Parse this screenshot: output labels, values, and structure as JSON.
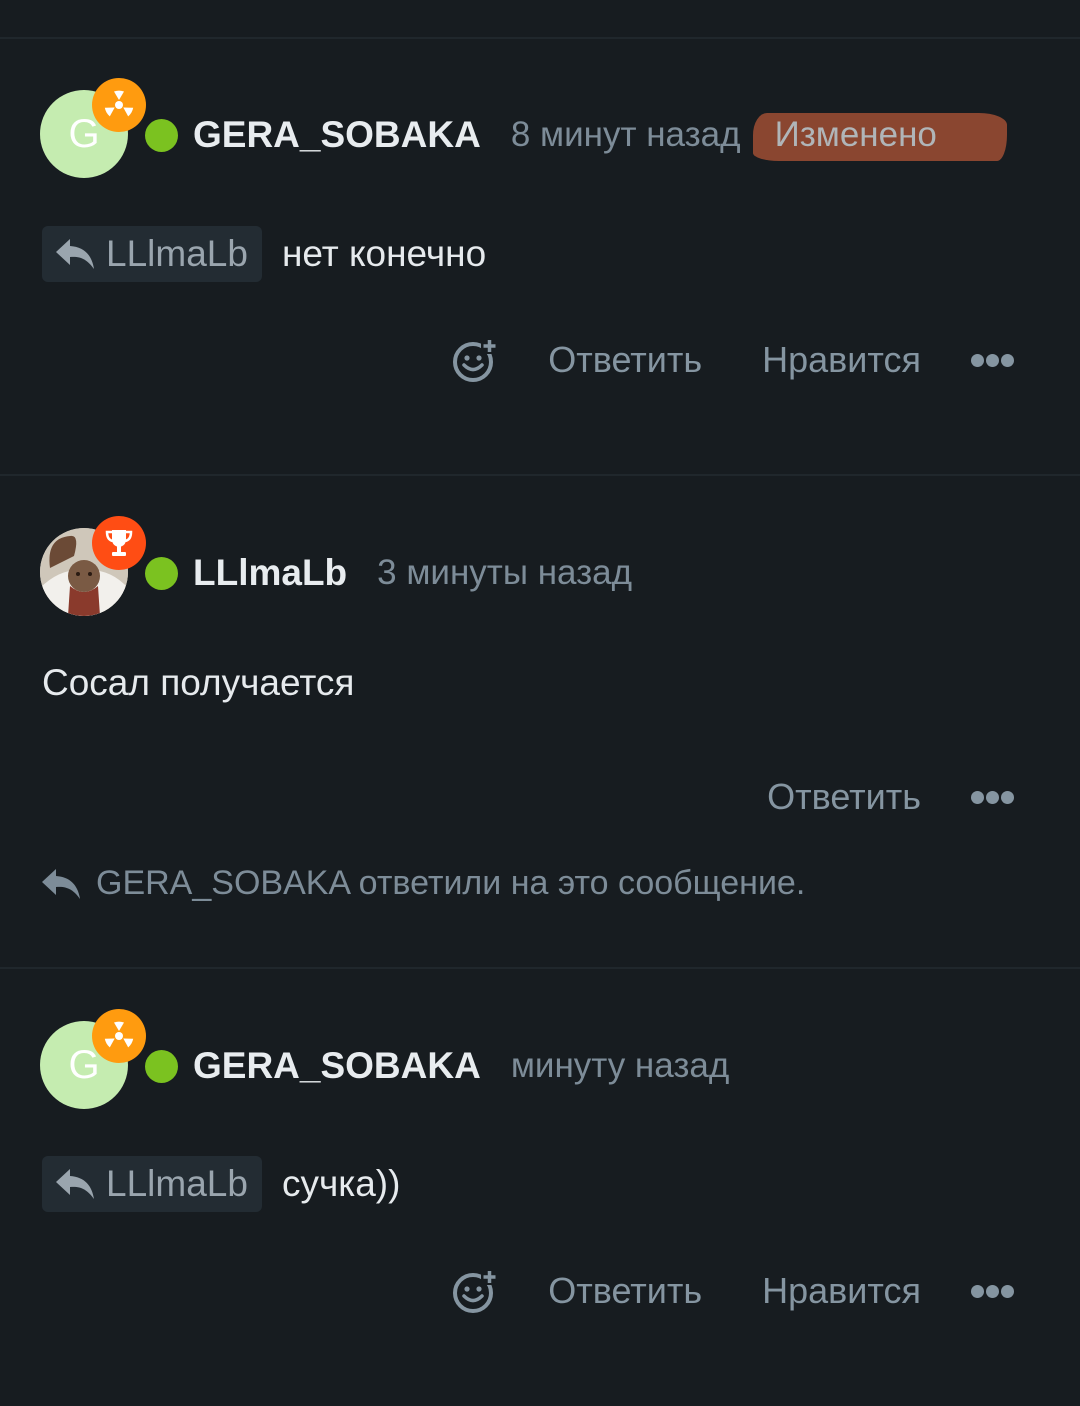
{
  "colors": {
    "background": "#171c20",
    "divider": "#20272c",
    "online": "#7bc220",
    "badge_orange": "#ff9b0f",
    "badge_red": "#ff4d14",
    "edited_highlight": "#8a4630",
    "muted_text": "#7d8c98"
  },
  "posts": [
    {
      "avatar_letter": "G",
      "badge_icon": "radioactive-icon",
      "username": "GERA_SOBAKA",
      "time": "8 минут назад",
      "edited_label": "Изменено",
      "reply_to": "LLlmaLb",
      "message": "нет конечно",
      "actions": {
        "reply": "Ответить",
        "like": "Нравится"
      }
    },
    {
      "avatar_icon": "user-photo-avatar",
      "badge_icon": "trophy-icon",
      "username": "LLlmaLb",
      "time": "3 минуты назад",
      "message": "Сосал получается",
      "actions": {
        "reply": "Ответить"
      },
      "replied_note": "GERA_SOBAKA ответили на это сообщение."
    },
    {
      "avatar_letter": "G",
      "badge_icon": "radioactive-icon",
      "username": "GERA_SOBAKA",
      "time": "минуту назад",
      "reply_to": "LLlmaLb",
      "message": "сучка))",
      "actions": {
        "reply": "Ответить",
        "like": "Нравится"
      }
    }
  ]
}
